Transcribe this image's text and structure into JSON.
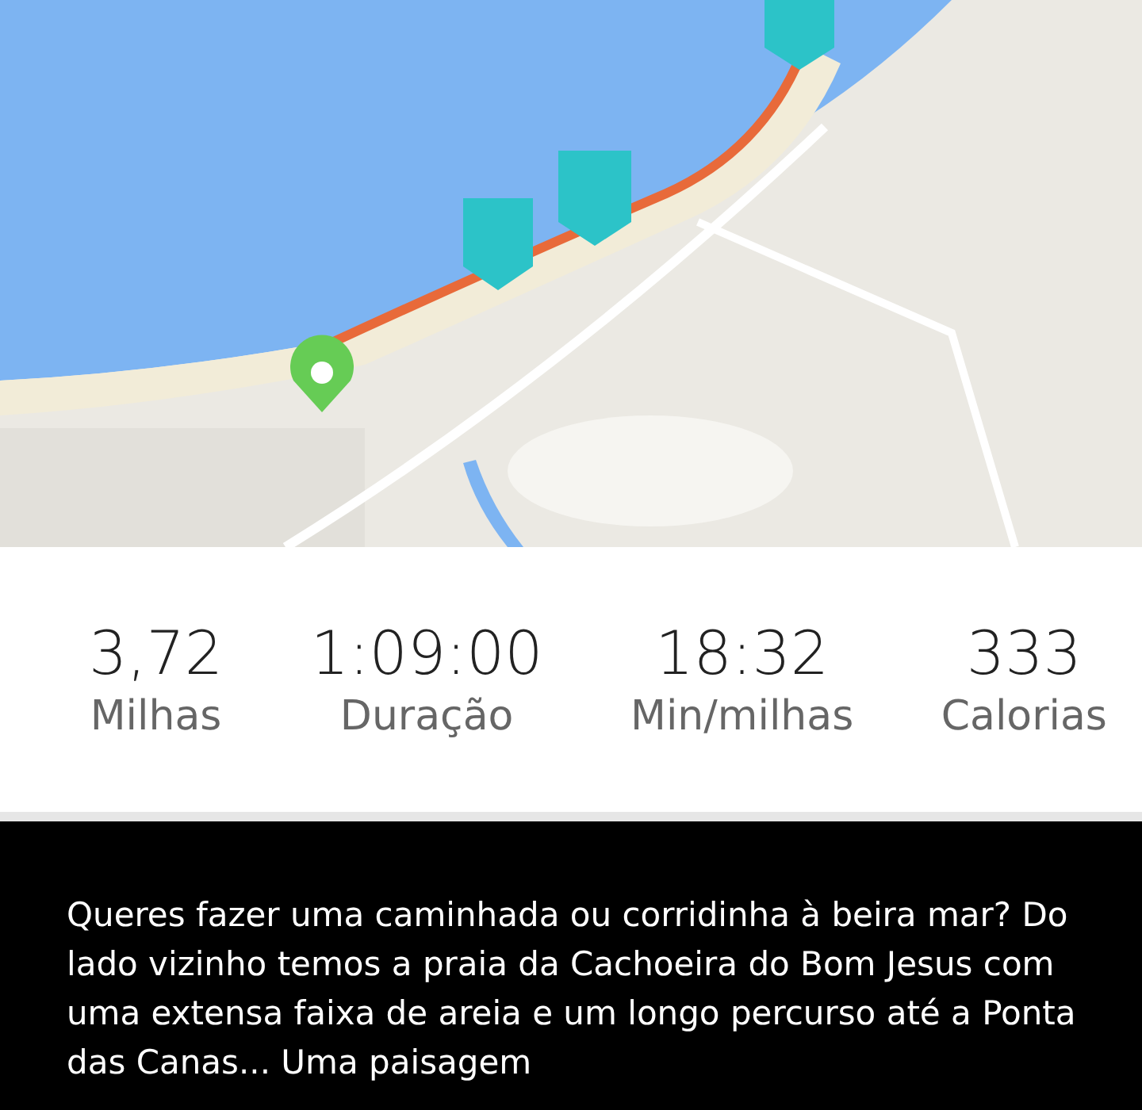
{
  "stats": [
    {
      "value": "3,72",
      "label": "Milhas"
    },
    {
      "value": "1:09:00",
      "label": "Duração"
    },
    {
      "value": "18:32",
      "label": "Min/milhas"
    },
    {
      "value": "333",
      "label": "Calorias"
    }
  ],
  "post": {
    "text": "Queres fazer uma caminhada ou corridinha à beira mar?  Do lado vizinho temos a praia da Cachoeira do Bom Jesus com uma extensa faixa de areia e um longo percurso até a Ponta das Canas... Uma paisagem"
  }
}
